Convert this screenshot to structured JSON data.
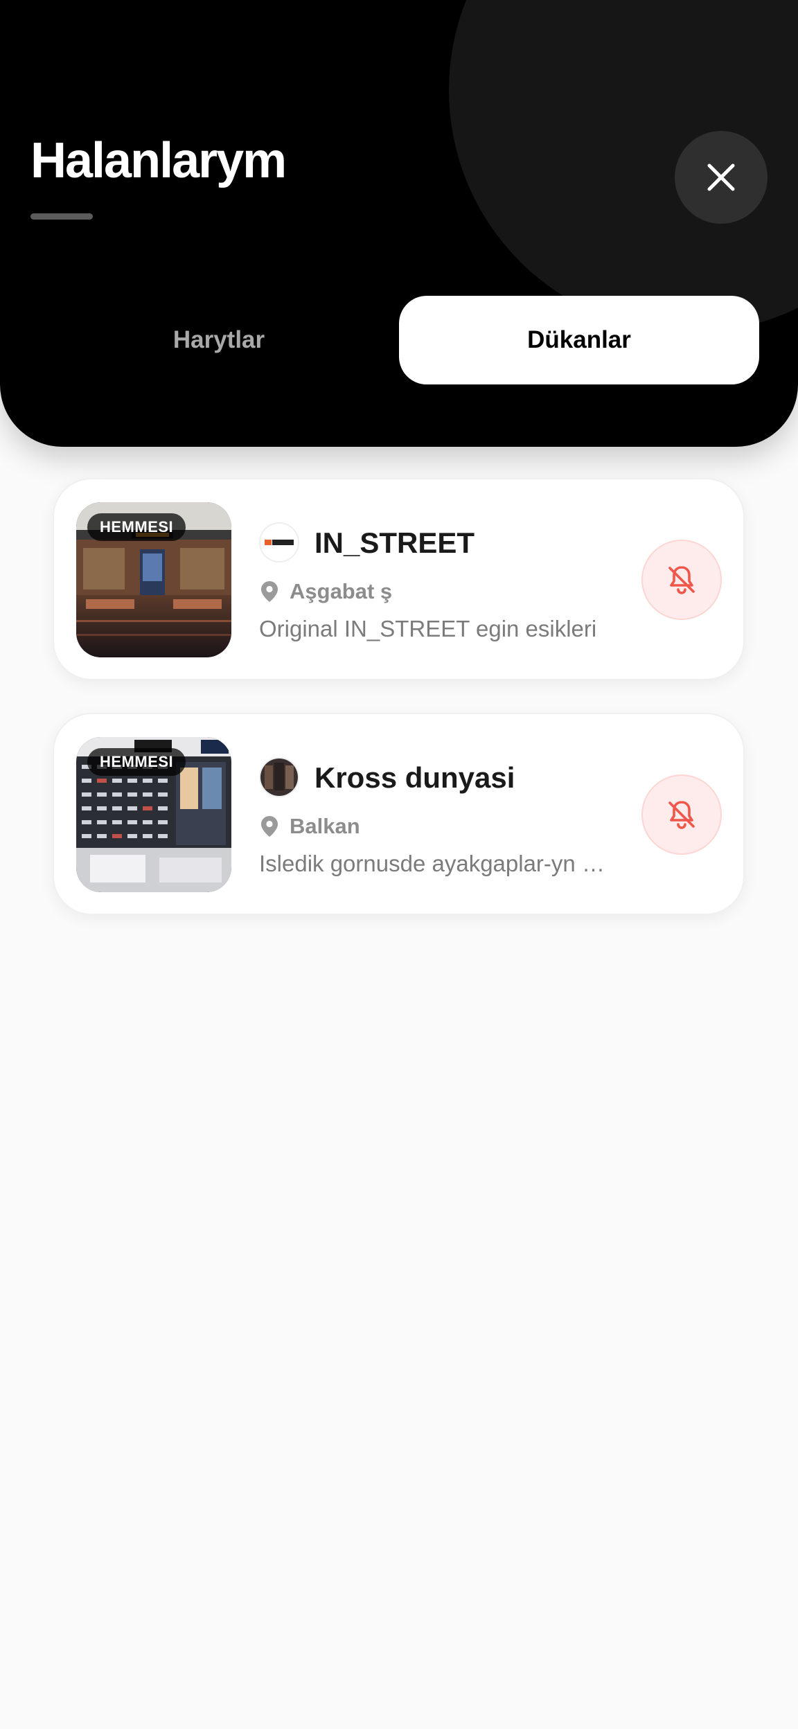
{
  "header": {
    "title": "Halanlarym",
    "close_icon": "close-icon"
  },
  "tabs": [
    {
      "label": "Harytlar",
      "active": false
    },
    {
      "label": "Dükanlar",
      "active": true
    }
  ],
  "shops": [
    {
      "badge": "HEMMESI",
      "logo_text": "INSTREET",
      "name": "IN_STREET",
      "location": "Aşgabat ş",
      "description": "Original IN_STREET egin esikleri",
      "action_icon": "bell-off-icon"
    },
    {
      "badge": "HEMMESI",
      "name": "Kross dunyasi",
      "location": "Balkan",
      "description": "Isledik gornusde ayakgaplar-yn we sport harytlar",
      "action_icon": "bell-off-icon"
    }
  ],
  "colors": {
    "header_bg": "#000000",
    "active_tab_bg": "#ffffff",
    "bell_accent": "#f0564a",
    "page_bg": "#fafafa"
  }
}
